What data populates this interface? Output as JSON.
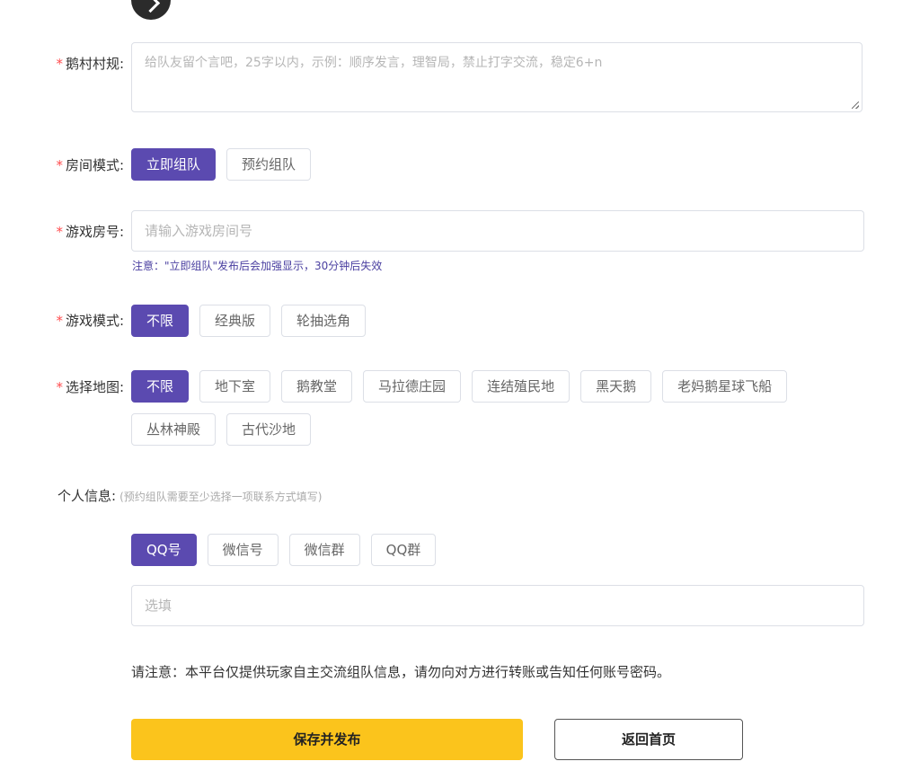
{
  "rules": {
    "label": "鹅村村规:",
    "placeholder": "给队友留个言吧，25字以内，示例：顺序发言，理智局，禁止打字交流，稳定6+n"
  },
  "room_mode": {
    "label": "房间模式:",
    "options": [
      "立即组队",
      "预约组队"
    ]
  },
  "room_number": {
    "label": "游戏房号:",
    "placeholder": "请输入游戏房间号",
    "note": "注意：\"立即组队\"发布后会加强显示，30分钟后失效"
  },
  "game_mode": {
    "label": "游戏模式:",
    "options": [
      "不限",
      "经典版",
      "轮抽选角"
    ]
  },
  "map": {
    "label": "选择地图:",
    "options": [
      "不限",
      "地下室",
      "鹅教堂",
      "马拉德庄园",
      "连结殖民地",
      "黑天鹅",
      "老妈鹅星球飞船",
      "丛林神殿",
      "古代沙地"
    ]
  },
  "personal_info": {
    "label": "个人信息:",
    "hint": "(预约组队需要至少选择一项联系方式填写)",
    "options": [
      "QQ号",
      "微信号",
      "微信群",
      "QQ群"
    ],
    "placeholder": "选填"
  },
  "warning": "请注意：本平台仅提供玩家自主交流组队信息，请勿向对方进行转账或告知任何账号密码。",
  "actions": {
    "submit": "保存并发布",
    "back": "返回首页"
  }
}
